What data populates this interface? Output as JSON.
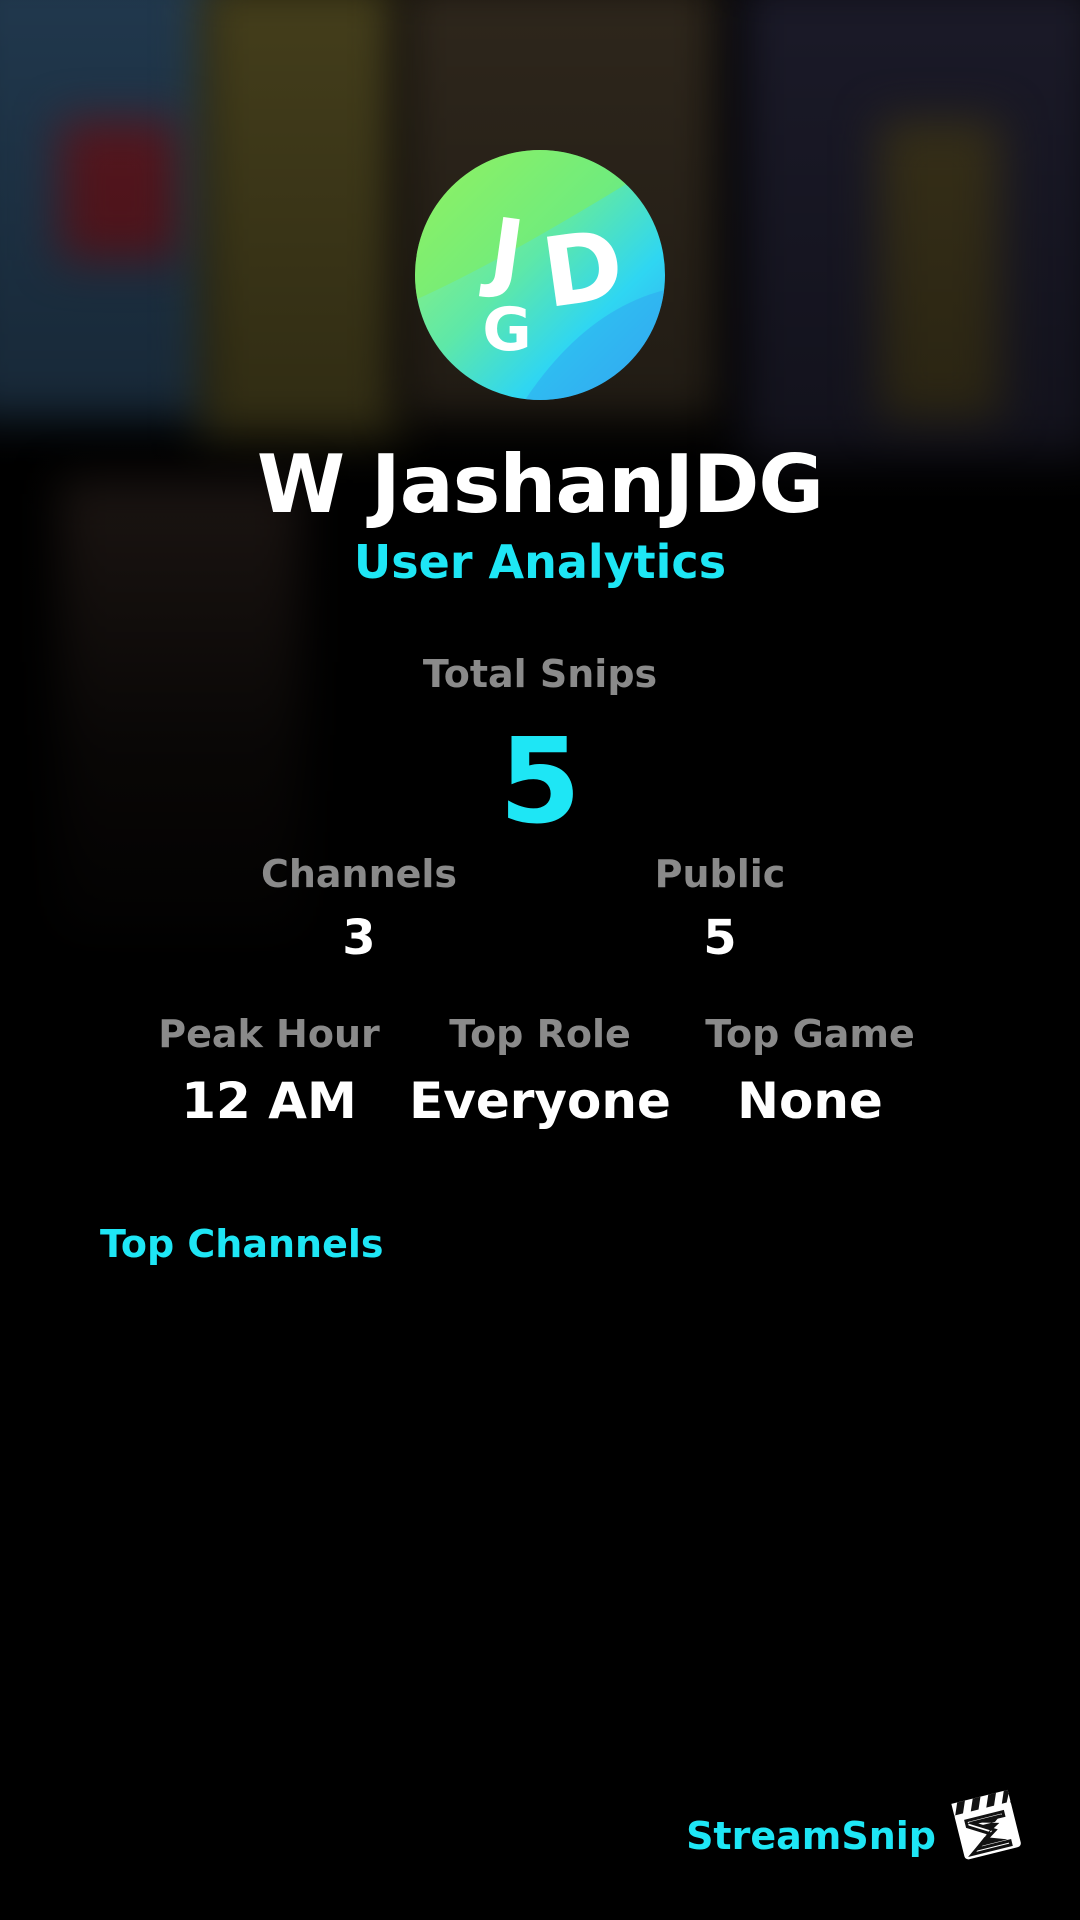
{
  "profile": {
    "avatar_text": "JGD",
    "username": "W JashanJDG",
    "subtitle": "User Analytics"
  },
  "stats": {
    "total_snips_label": "Total Snips",
    "total_snips_value": "5",
    "channels_label": "Channels",
    "channels_value": "3",
    "public_label": "Public",
    "public_value": "5",
    "peak_hour_label": "Peak Hour",
    "peak_hour_value": "12 AM",
    "top_role_label": "Top Role",
    "top_role_value": "Everyone",
    "top_game_label": "Top Game",
    "top_game_value": "None"
  },
  "sections": {
    "top_channels_label": "Top Channels"
  },
  "brand": {
    "name": "StreamSnip",
    "logo_icon": "clapperboard-logo-icon"
  },
  "colors": {
    "accent": "#1ee6f5",
    "label_gray": "#8a8a8a",
    "background": "#000000"
  }
}
